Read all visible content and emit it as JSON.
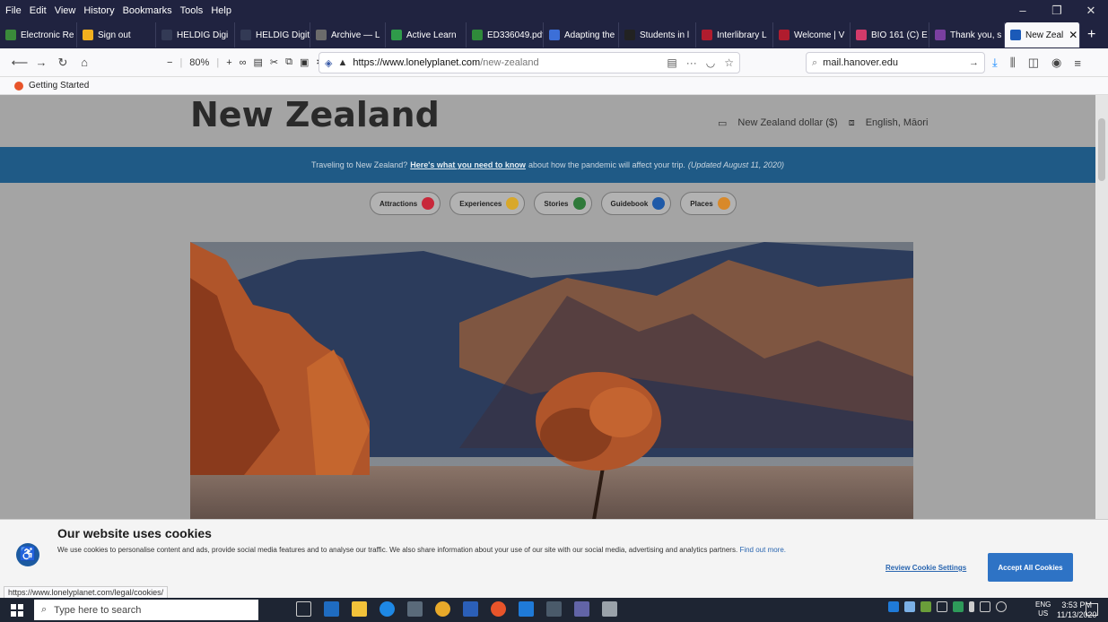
{
  "menu": [
    "File",
    "Edit",
    "View",
    "History",
    "Bookmarks",
    "Tools",
    "Help"
  ],
  "tabs": [
    {
      "label": "Electronic Re",
      "color": "#3a8a3a"
    },
    {
      "label": "Sign out",
      "color": "#f2b01e"
    },
    {
      "label": "HELDIG Digi",
      "color": "#333a55"
    },
    {
      "label": "HELDIG Digit",
      "color": "#333a55"
    },
    {
      "label": "Archive — L",
      "color": "#6b6b6b"
    },
    {
      "label": "Active Learn",
      "color": "#2f9a4a"
    },
    {
      "label": "ED336049.pdf",
      "color": "#2f8a3a"
    },
    {
      "label": "Adapting the",
      "color": "#3c6fd8"
    },
    {
      "label": "Students in l",
      "color": "#222222"
    },
    {
      "label": "Interlibrary L",
      "color": "#b01c2e"
    },
    {
      "label": "Welcome | V",
      "color": "#b01c2e"
    },
    {
      "label": "BIO 161 (C) E",
      "color": "#d23a6a"
    },
    {
      "label": "Thank you, s",
      "color": "#7a3fa0"
    },
    {
      "label": "New Zeal",
      "color": "#1b5ab8"
    }
  ],
  "toolbar": {
    "zoom": "80%",
    "url_host": "https://www.lonelyplanet.com",
    "url_path": "/new-zealand",
    "search_value": "mail.hanover.edu"
  },
  "bookmarks": {
    "getting_started": "Getting Started"
  },
  "page": {
    "title": "New Zealand",
    "currency": "New Zealand dollar ($)",
    "language": "English, Māori",
    "banner_pre": "Traveling to New Zealand?",
    "banner_link": "Here's what you need to know",
    "banner_post": "about how the pandemic will affect your trip.",
    "banner_updated": "(Updated August 11, 2020)",
    "pills": [
      {
        "label": "Attractions",
        "color": "#c8283a"
      },
      {
        "label": "Experiences",
        "color": "#d8a82a"
      },
      {
        "label": "Stories",
        "color": "#2f7a3a"
      },
      {
        "label": "Guidebook",
        "color": "#1f5aa8"
      },
      {
        "label": "Places",
        "color": "#d8892a"
      }
    ]
  },
  "cookie": {
    "title": "Our website uses cookies",
    "text": "We use cookies to personalise content and ads, provide social media features and to analyse our traffic. We also share information about your use of our site with our social media, advertising and analytics partners.",
    "find_out": "Find out more.",
    "review": "Review Cookie Settings",
    "accept": "Accept All Cookies",
    "status_url": "https://www.lonelyplanet.com/legal/cookies/"
  },
  "taskbar": {
    "search_placeholder": "Type here to search",
    "lang_top": "ENG",
    "lang_bottom": "US",
    "time": "3:53 PM",
    "date": "11/13/2020"
  }
}
